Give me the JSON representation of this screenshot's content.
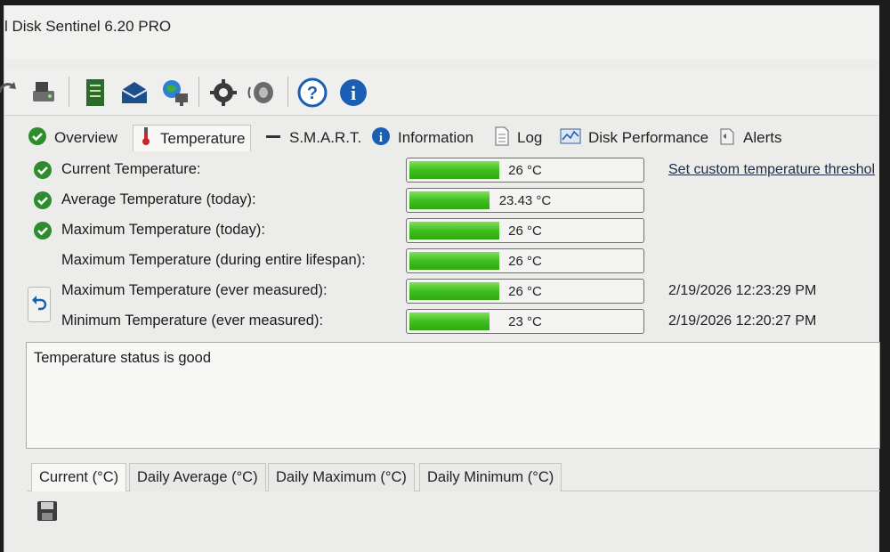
{
  "window": {
    "title": "l Disk Sentinel 6.20 PRO"
  },
  "toolbar": {
    "icons": [
      "refresh-icon",
      "disk-icon",
      "report-icon",
      "email-icon",
      "network-icon",
      "settings-icon",
      "sound-icon",
      "help-icon",
      "info-icon"
    ]
  },
  "tabs": [
    {
      "label": "Overview",
      "icon": "check-icon"
    },
    {
      "label": "Temperature",
      "icon": "thermometer-icon",
      "active": true
    },
    {
      "label": "S.M.A.R.T.",
      "icon": "dash-icon"
    },
    {
      "label": "Information",
      "icon": "info-icon"
    },
    {
      "label": "Log",
      "icon": "document-icon"
    },
    {
      "label": "Disk Performance",
      "icon": "chart-icon"
    },
    {
      "label": "Alerts",
      "icon": "alerts-icon"
    }
  ],
  "temperature": {
    "rows": [
      {
        "label": "Current Temperature:",
        "value": "26 °C",
        "fill": 0.39,
        "status_icon": "check-icon",
        "right": "Set custom temperature threshol"
      },
      {
        "label": "Average Temperature (today):",
        "value": "23.43 °C",
        "fill": 0.35,
        "status_icon": "check-icon",
        "right": ""
      },
      {
        "label": "Maximum Temperature (today):",
        "value": "26 °C",
        "fill": 0.39,
        "status_icon": "check-icon",
        "right": ""
      },
      {
        "label": "Maximum Temperature (during entire lifespan):",
        "value": "26 °C",
        "fill": 0.39,
        "status_icon": "",
        "right": ""
      },
      {
        "label": "Maximum Temperature (ever measured):",
        "value": "26 °C",
        "fill": 0.39,
        "status_icon": "",
        "right": "2/19/2026 12:23:29 PM"
      },
      {
        "label": "Minimum Temperature (ever measured):",
        "value": "23 °C",
        "fill": 0.35,
        "status_icon": "",
        "right": "2/19/2026 12:20:27 PM"
      }
    ],
    "status": "Temperature status is good"
  },
  "subtabs": [
    {
      "label": "Current (°C)",
      "active": true
    },
    {
      "label": "Daily Average (°C)"
    },
    {
      "label": "Daily Maximum (°C)"
    },
    {
      "label": "Daily Minimum (°C)"
    }
  ],
  "colors": {
    "bar_green": "#3fbe1e",
    "check_green": "#2e8b2e",
    "info_blue": "#1a5fb4"
  }
}
